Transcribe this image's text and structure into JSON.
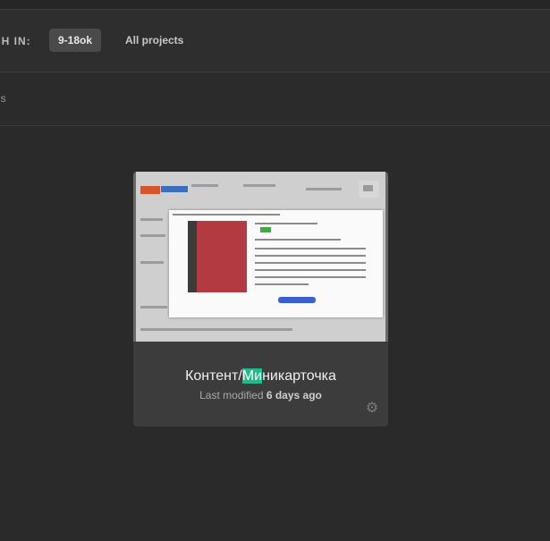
{
  "filter": {
    "search_in_label": "CH IN:",
    "chips": [
      "9-18ok",
      "All projects"
    ]
  },
  "subbar": {
    "text": "ns"
  },
  "card": {
    "title_pre": "Контент/",
    "title_highlight": "Ми",
    "title_post": "никарточка",
    "meta_prefix": "Last modified",
    "meta_age": "6 days ago",
    "icons": [
      "comment-icon",
      "gear-icon"
    ]
  },
  "colors": {
    "highlight": "#1fb98a",
    "background": "#2b2b2b",
    "card": "#3c3c3c"
  }
}
